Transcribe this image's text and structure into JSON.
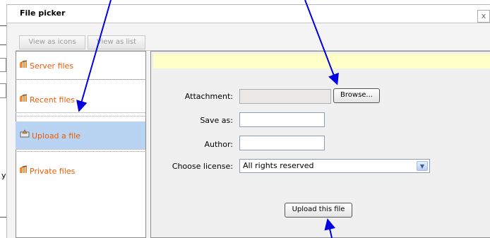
{
  "dialog": {
    "title": "File picker",
    "close_label": "x"
  },
  "toolbar": {
    "icons_label": "View as icons",
    "list_label": "View as list"
  },
  "sidebar": {
    "items": [
      {
        "label": "Server files",
        "icon": "moodle-icon"
      },
      {
        "label": "Recent files",
        "icon": "moodle-icon"
      },
      {
        "label": "Upload a file",
        "icon": "upload-icon",
        "active": true
      },
      {
        "label": "Private files",
        "icon": "moodle-icon"
      }
    ]
  },
  "form": {
    "attachment_label": "Attachment:",
    "browse_label": "Browse...",
    "saveas_label": "Save as:",
    "author_label": "Author:",
    "license_label": "Choose license:",
    "license_value": "All rights reserved",
    "upload_label": "Upload this file"
  },
  "background": {
    "stray_char": "y"
  },
  "colors": {
    "link_orange": "#f05a05",
    "active_blue": "#b8d4f2",
    "arrow_blue": "#0000e0",
    "notice_yellow": "#ffffc8"
  }
}
